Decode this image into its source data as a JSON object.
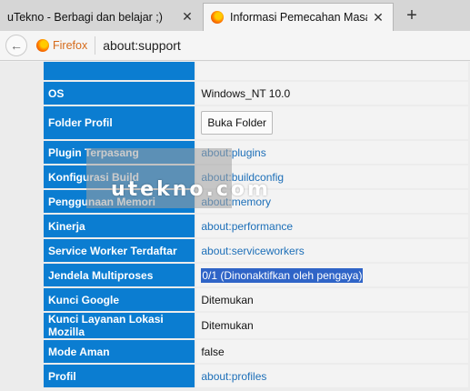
{
  "tabs": [
    {
      "label": "uTekno - Berbagi dan belajar ;)",
      "active": false
    },
    {
      "label": "Informasi Pemecahan Masalah",
      "active": true
    }
  ],
  "tab_close_glyph": "✕",
  "new_tab_glyph": "+",
  "nav": {
    "back_glyph": "←",
    "identity_label": "Firefox",
    "url": "about:support"
  },
  "rows": [
    {
      "key": "",
      "value": "",
      "type": "text"
    },
    {
      "key": "OS",
      "value": "Windows_NT 10.0",
      "type": "text"
    },
    {
      "key": "Folder Profil",
      "value": "Buka Folder",
      "type": "button"
    },
    {
      "key": "Plugin Terpasang",
      "value": "about:plugins",
      "type": "link"
    },
    {
      "key": "Konfigurasi Build",
      "value": "about:buildconfig",
      "type": "link"
    },
    {
      "key": "Penggunaan Memori",
      "value": "about:memory",
      "type": "link"
    },
    {
      "key": "Kinerja",
      "value": "about:performance",
      "type": "link"
    },
    {
      "key": "Service Worker Terdaftar",
      "value": "about:serviceworkers",
      "type": "link"
    },
    {
      "key": "Jendela Multiproses",
      "value": "0/1 (Dinonaktifkan oleh pengaya)",
      "type": "selected"
    },
    {
      "key": "Kunci Google",
      "value": "Ditemukan",
      "type": "text"
    },
    {
      "key": "Kunci Layanan Lokasi Mozilla",
      "value": "Ditemukan",
      "type": "text"
    },
    {
      "key": "Mode Aman",
      "value": "false",
      "type": "text"
    },
    {
      "key": "Profil",
      "value": "about:profiles",
      "type": "link"
    }
  ],
  "watermark": "utekno.com",
  "colors": {
    "key_cell": "#0b7dd1",
    "link": "#1d6fb8",
    "selection": "#2f64c7",
    "identity": "#d66a1a"
  }
}
